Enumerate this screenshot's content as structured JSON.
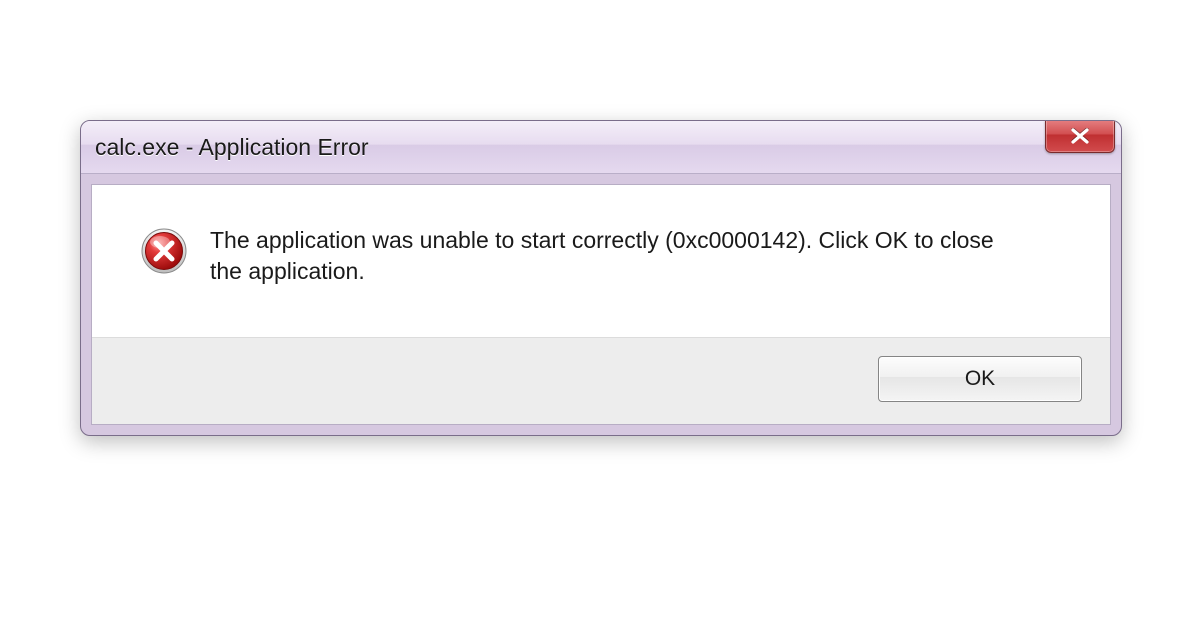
{
  "dialog": {
    "title": "calc.exe - Application Error",
    "message": "The application was unable to start correctly (0xc0000142). Click OK to close the application.",
    "ok_label": "OK"
  }
}
